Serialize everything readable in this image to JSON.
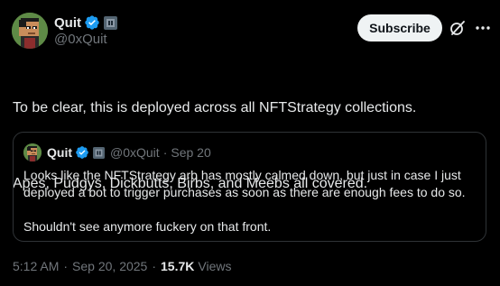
{
  "author": {
    "display_name": "Quit",
    "handle": "@0xQuit",
    "avatar": "pixel-art-green-character-avatar",
    "verified": true,
    "affiliate_badge": "gray-square-badge"
  },
  "actions": {
    "subscribe_label": "Subscribe",
    "grok_icon": "grok-slash-icon",
    "more_icon": "more-dots-icon"
  },
  "tweet": {
    "paragraphs": [
      "To be clear, this is deployed across all NFTStrategy collections.",
      "Apes, Pudgys, Dickbutts, Birbs, and Meebs all covered."
    ]
  },
  "quote": {
    "display_name": "Quit",
    "handle": "@0xQuit",
    "separator": "·",
    "date": "Sep 20",
    "paragraphs": [
      "Looks like the NFTStrategy arb has mostly calmed down, but just in case I just deployed a bot to trigger purchases as soon as there are enough fees to do so.",
      "Shouldn't see anymore fuckery on that front."
    ]
  },
  "meta": {
    "time": "5:12 AM",
    "separator": "·",
    "date": "Sep 20, 2025",
    "views_count": "15.7K",
    "views_label": "Views"
  },
  "colors": {
    "background": "#000000",
    "text": "#e7e9ea",
    "muted": "#71767b",
    "verified": "#1d9bf0",
    "border": "#2f3336"
  }
}
